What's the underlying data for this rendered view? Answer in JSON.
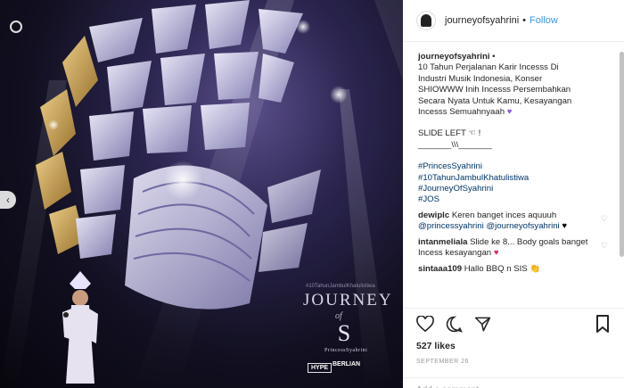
{
  "photo": {
    "overlay_hashtag": "#10TahunJambulKhatulistiwa",
    "title_word": "JOURNEY",
    "title_of": "of",
    "monogram": "S",
    "signature": "PrincessSyahrini",
    "sponsor_1": "HYPE",
    "sponsor_2": "BERLIAN",
    "carousel_prev": "‹"
  },
  "header": {
    "username": "journeyofsyahrini",
    "separator": "•",
    "follow_label": "Follow"
  },
  "caption": {
    "username": "journeyofsyahrini",
    "separator": "•",
    "lines": [
      "10 Tahun Perjalanan Karir Incesss Di",
      "Industri Musik Indonesia, Konser",
      "SHIOWWW Inih Incesss Persembahkan",
      "Secara Nyata Untuk Kamu, Kesayangan",
      "Incesss Semuahnyaah"
    ],
    "slide_left": "SLIDE LEFT ☜ !",
    "divider": "_______\\\\\\_______",
    "hashtags": [
      "#PrincesSyahrini",
      "#10TahunJambulKhatulistiwa",
      "#JourneyOfSyahrini",
      "#JOS"
    ]
  },
  "comments": [
    {
      "username": "dewiplc",
      "text": "Keren banget inces aquuuh",
      "mention_1": "@princessyahrini",
      "mention_2": "@journeyofsyahrini",
      "emoji": "♥"
    },
    {
      "username": "intanmeliala",
      "text": "Slide ke 8... Body goals banget Incess kesayangan",
      "emoji": "♥"
    },
    {
      "username": "sintaaa109",
      "text": "Hallo BBQ n SIS",
      "emoji": "👏"
    }
  ],
  "actions": {
    "likes": "527 likes",
    "date": "SEPTEMBER 26",
    "add_comment_placeholder": "Add a comment..."
  },
  "colors": {
    "link_blue": "#3897f0",
    "hashtag_blue": "#003569",
    "purple_heart": "#8e5bd8",
    "red_heart": "#e0245e"
  }
}
